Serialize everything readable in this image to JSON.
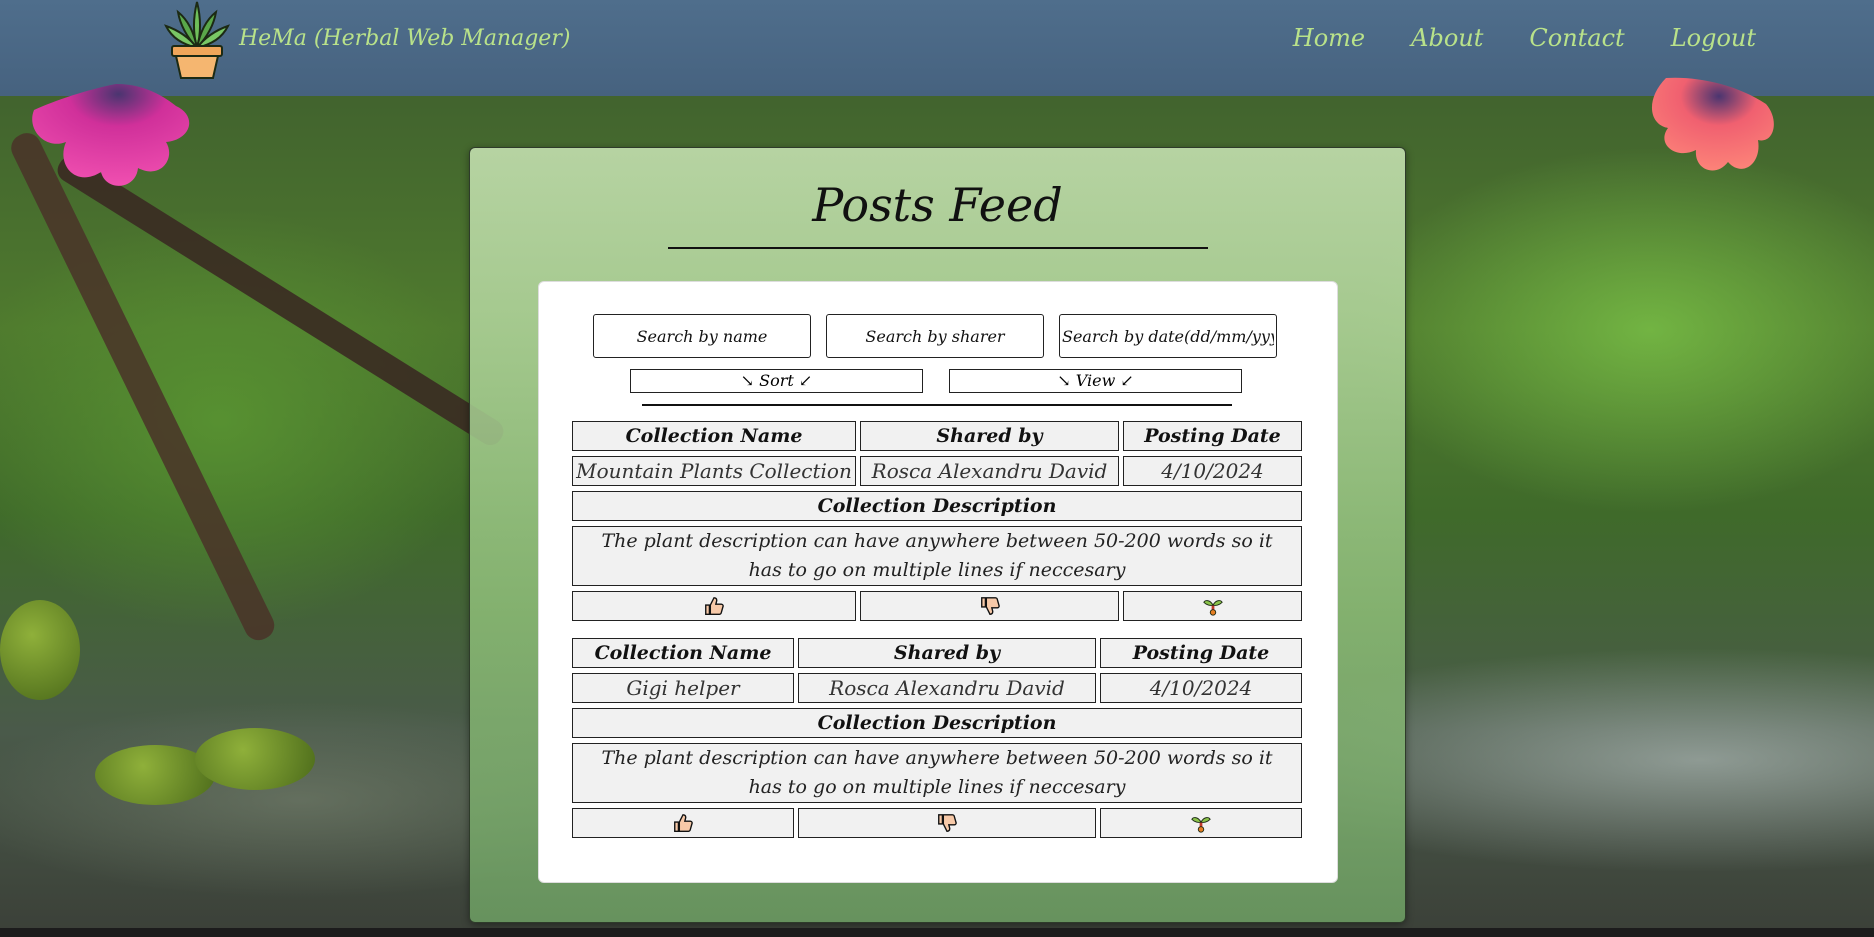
{
  "header": {
    "brand": "HeMa (Herbal Web Manager)",
    "nav": [
      "Home",
      "About",
      "Contact",
      "Logout"
    ]
  },
  "feed": {
    "title": "Posts Feed",
    "search": {
      "name_placeholder": "Search by name",
      "sharer_placeholder": "Search by sharer",
      "date_placeholder": "Search by date(dd/mm/yyyy)"
    },
    "sort_label": "↘ Sort ↙",
    "view_label": "↘ View ↙",
    "posts": [
      {
        "headers": [
          "Collection Name",
          "Shared by",
          "Posting Date"
        ],
        "values": [
          "Mountain Plants Collection",
          "Rosca Alexandru David",
          "4/10/2024"
        ],
        "desc_header": "Collection Description",
        "description": "The plant description can have anywhere between 50-200 words so it has to go on multiple lines if neccesary",
        "actions": [
          "thumbs-up-icon",
          "thumbs-down-icon",
          "sprout-icon"
        ]
      },
      {
        "headers": [
          "Collection Name",
          "Shared by",
          "Posting Date"
        ],
        "values": [
          "Gigi helper",
          "Rosca Alexandru David",
          "4/10/2024"
        ],
        "desc_header": "Collection Description",
        "description": "The plant description can have anywhere between 50-200 words so it has to go on multiple lines if neccesary",
        "actions": [
          "thumbs-up-icon",
          "thumbs-down-icon",
          "sprout-icon"
        ]
      }
    ]
  },
  "colors": {
    "topbar": "#4f6e8c",
    "brand_text": "#b9e28a",
    "panel": "#c6e2b2",
    "cell_bg": "#f1f1f1"
  }
}
